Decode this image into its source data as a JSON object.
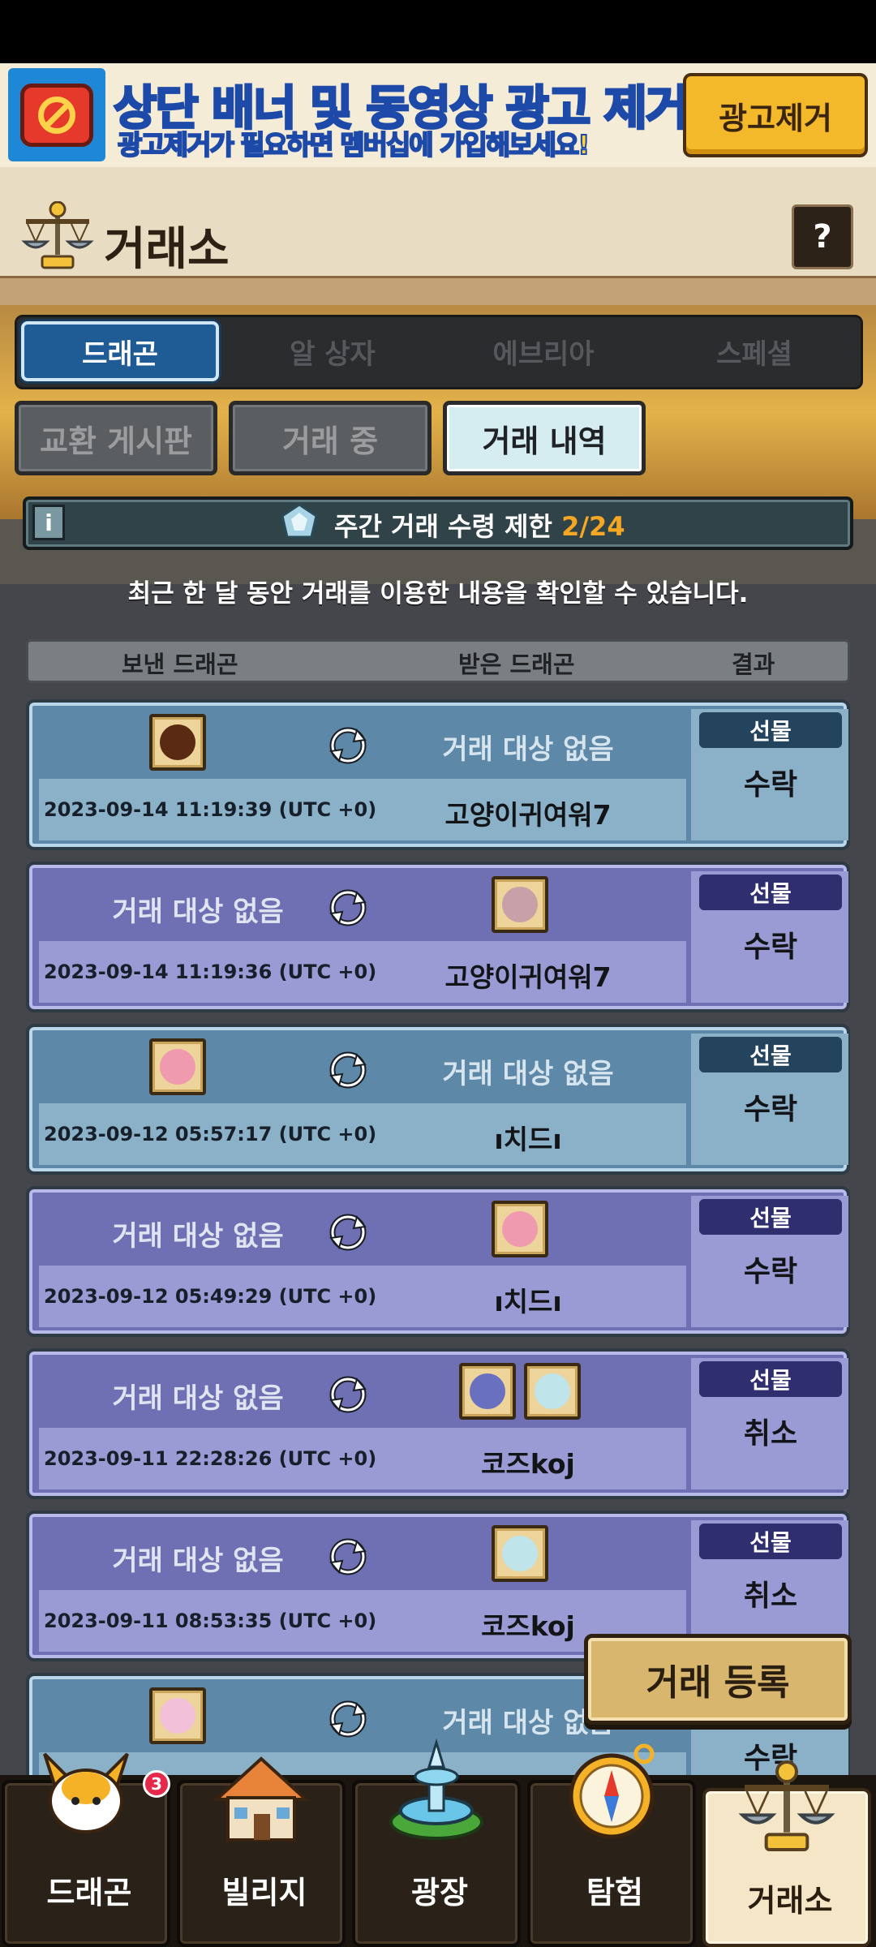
{
  "ad": {
    "title": "상단 배너 및 동영상 광고 제거!",
    "subtitle": "광고제거가 필요하면 멤버십에 가입해보세요!",
    "button": "광고제거"
  },
  "header": {
    "title": "거래소",
    "help": "?"
  },
  "category_tabs": [
    "드래곤",
    "알 상자",
    "에브리아",
    "스페셜"
  ],
  "sub_tabs": [
    "교환 게시판",
    "거래 중",
    "거래 내역"
  ],
  "info": {
    "label": "주간 거래 수령 제한",
    "count": "2/24",
    "icon": "i"
  },
  "description": "최근 한 달 동안 거래를 이용한 내용을 확인할 수 있습니다.",
  "table_header": {
    "sent": "보낸 드래곤",
    "received": "받은 드래곤",
    "result": "결과"
  },
  "rows": [
    {
      "color": "blue",
      "sent": "",
      "received": "거래 대상 없음",
      "timestamp": "2023-09-14 11:19:39 (UTC +0)",
      "partner": "고양이귀여워7",
      "badge": "선물",
      "status": "수락"
    },
    {
      "color": "purple",
      "sent": "거래 대상 없음",
      "received": "",
      "timestamp": "2023-09-14 11:19:36 (UTC +0)",
      "partner": "고양이귀여워7",
      "badge": "선물",
      "status": "수락"
    },
    {
      "color": "blue",
      "sent": "",
      "received": "거래 대상 없음",
      "timestamp": "2023-09-12 05:57:17 (UTC +0)",
      "partner": "ı치드ı",
      "badge": "선물",
      "status": "수락"
    },
    {
      "color": "purple",
      "sent": "거래 대상 없음",
      "received": "",
      "timestamp": "2023-09-12 05:49:29 (UTC +0)",
      "partner": "ı치드ı",
      "badge": "선물",
      "status": "수락"
    },
    {
      "color": "purple",
      "sent": "거래 대상 없음",
      "received": "",
      "timestamp": "2023-09-11 22:28:26 (UTC +0)",
      "partner": "코즈koj",
      "badge": "선물",
      "status": "취소"
    },
    {
      "color": "purple",
      "sent": "거래 대상 없음",
      "received": "",
      "timestamp": "2023-09-11 08:53:35 (UTC +0)",
      "partner": "코즈koj",
      "badge": "선물",
      "status": "취소"
    },
    {
      "color": "blue",
      "sent": "",
      "received": "거래 대상 없음",
      "timestamp": "",
      "partner": "",
      "badge": "",
      "status": "수락"
    }
  ],
  "register_button": "거래 등록",
  "nav": {
    "items": [
      "드래곤",
      "빌리지",
      "광장",
      "탐험",
      "거래소"
    ],
    "badge_count": "3"
  },
  "colors": {
    "accent_orange": "#f5a623",
    "active_tab": "#1f5b95",
    "row_blue": "#5d88a8",
    "row_purple": "#6f6fb3"
  }
}
